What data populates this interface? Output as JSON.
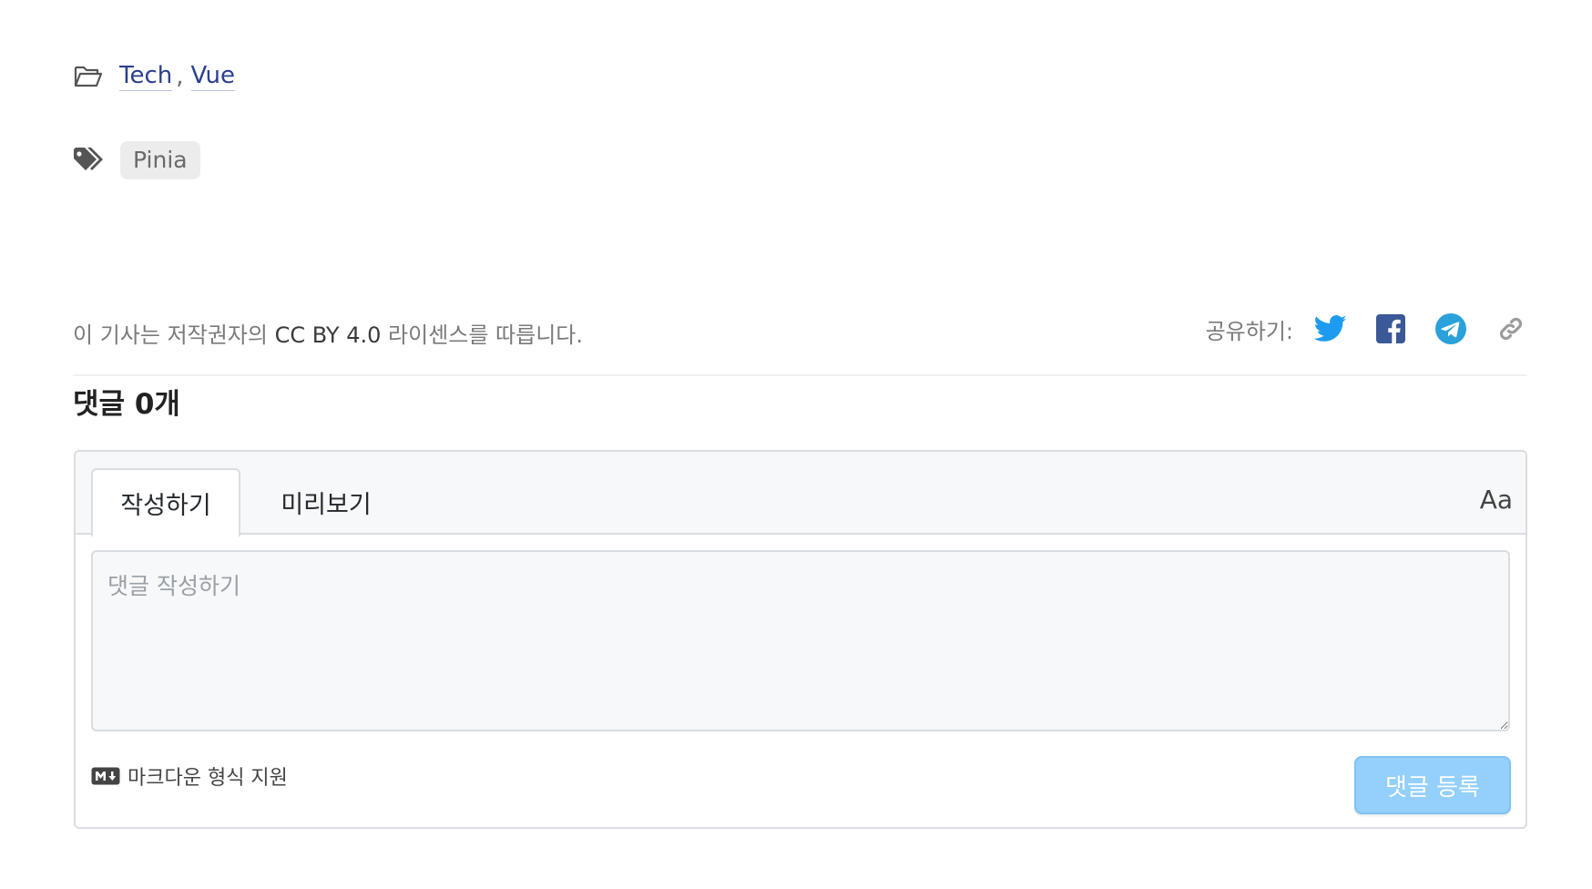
{
  "categories": {
    "icon": "folder-open-icon",
    "items": [
      "Tech",
      "Vue"
    ],
    "separator": ","
  },
  "tags": {
    "icon": "tags-icon",
    "items": [
      "Pinia"
    ]
  },
  "license": {
    "prefix": "이 기사는 저작권자의",
    "name": "CC BY 4.0",
    "suffix": "라이센스를 따릅니다."
  },
  "share": {
    "label": "공유하기:",
    "buttons": [
      {
        "icon": "twitter-icon",
        "color": "#1d9bf0"
      },
      {
        "icon": "facebook-icon",
        "color": "#3b5998"
      },
      {
        "icon": "telegram-icon",
        "color": "#2aa1da"
      },
      {
        "icon": "link-icon",
        "color": "#9b9b9b"
      }
    ]
  },
  "comments": {
    "title": "댓글 0개",
    "tabs": {
      "write": "작성하기",
      "preview": "미리보기"
    },
    "font_toggle": "Aa",
    "textarea": {
      "value": "",
      "placeholder": "댓글 작성하기"
    },
    "markdown_hint": "마크다운 형식 지원",
    "markdown_icon": "markdown-icon",
    "submit_label": "댓글 등록",
    "submit_color": "#94d0fb"
  }
}
